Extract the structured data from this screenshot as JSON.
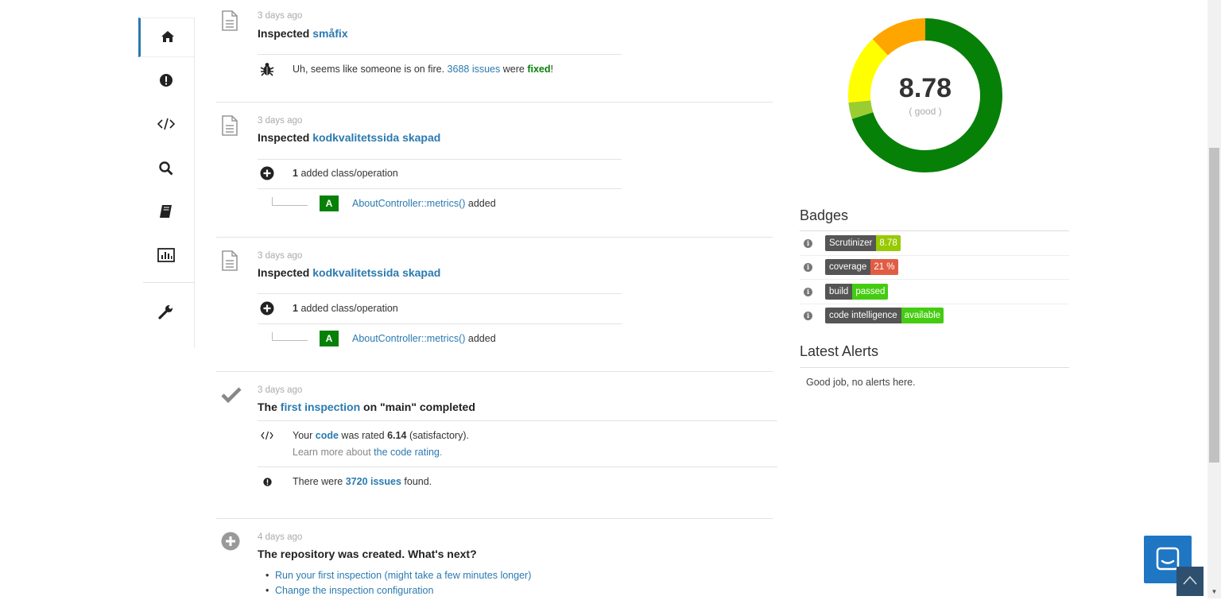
{
  "nav": {
    "items": [
      {
        "icon": "home-icon"
      },
      {
        "icon": "exclamation-icon"
      },
      {
        "icon": "code-icon"
      },
      {
        "icon": "search-icon"
      },
      {
        "icon": "book-icon"
      },
      {
        "icon": "bar-chart-icon"
      },
      {
        "icon": "wrench-icon"
      }
    ]
  },
  "timeline": {
    "e1": {
      "time": "3 days ago",
      "prefix": "Inspected",
      "link": "småfix",
      "msg_pre": "Uh, seems like someone is on fire.",
      "issues_link": "3688 issues",
      "msg_mid": "were",
      "fixed": "fixed",
      "msg_end": "!"
    },
    "e2": {
      "time": "3 days ago",
      "prefix": "Inspected",
      "link": "kodkvalitetssida skapad",
      "count": "1",
      "count_label": "added class/operation",
      "grade": "A",
      "method_link": "AboutController::metrics()",
      "method_suffix": "added"
    },
    "e3": {
      "time": "3 days ago",
      "prefix": "Inspected",
      "link": "kodkvalitetssida skapad",
      "count": "1",
      "count_label": "added class/operation",
      "grade": "A",
      "method_link": "AboutController::metrics()",
      "method_suffix": "added"
    },
    "e4": {
      "time": "3 days ago",
      "title_pre": "The",
      "title_link": "first inspection",
      "title_post": "on \"main\" completed",
      "rated_pre": "Your",
      "rated_code": "code",
      "rated_mid": "was rated",
      "rated_value": "6.14",
      "rated_post": "(satisfactory).",
      "learn_pre": "Learn more about",
      "learn_link": "the code rating",
      "learn_post": ".",
      "issues_pre": "There were",
      "issues_link": "3720 issues",
      "issues_post": "found."
    },
    "e5": {
      "time": "4 days ago",
      "title": "The repository was created. What's next?",
      "links": [
        "Run your first inspection (might take a few minutes longer)",
        "Change the inspection configuration"
      ]
    }
  },
  "score": {
    "value": "8.78",
    "label": "( good )",
    "segments": [
      {
        "color": "#078007",
        "fraction": 0.7
      },
      {
        "color": "#9acd32",
        "fraction": 0.035
      },
      {
        "color": "#ffff00",
        "fraction": 0.145
      },
      {
        "color": "#ffa500",
        "fraction": 0.12
      }
    ]
  },
  "badges": {
    "heading": "Badges",
    "items": [
      {
        "label": "Scrutinizer",
        "value": "8.78",
        "color": "#97ca00"
      },
      {
        "label": "coverage",
        "value": "21 %",
        "color": "#e05d44"
      },
      {
        "label": "build",
        "value": "passed",
        "color": "#44cc11"
      },
      {
        "label": "code intelligence",
        "value": "available",
        "color": "#44cc11"
      }
    ]
  },
  "alerts": {
    "heading": "Latest Alerts",
    "empty_text": "Good job, no alerts here."
  }
}
